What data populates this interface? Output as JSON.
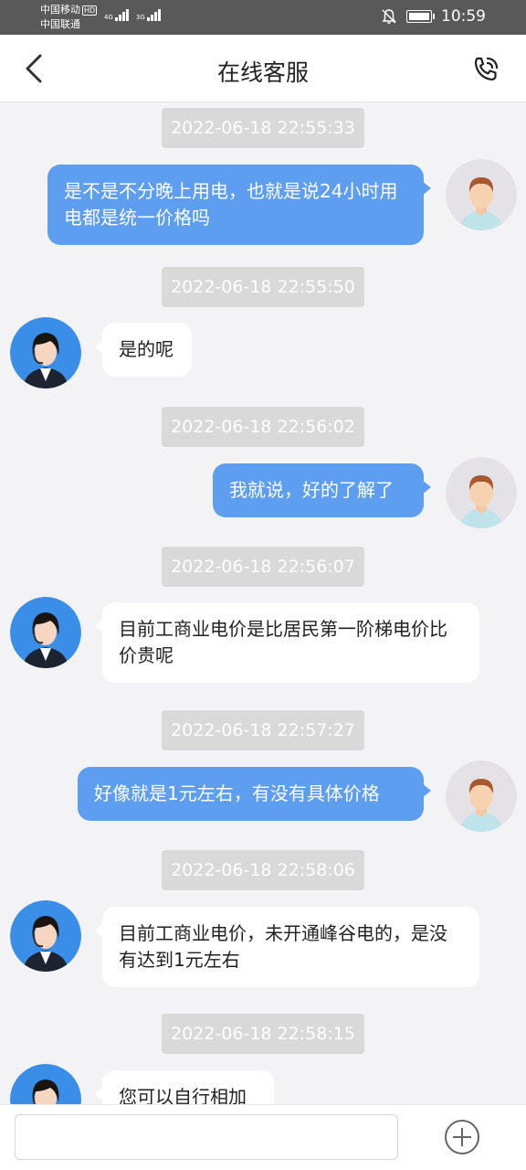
{
  "status_bar": {
    "carrier1": "中国移动",
    "hd": "HD",
    "carrier2": "中国联通",
    "sig1": "4G",
    "sig2": "3G",
    "time": "10:59"
  },
  "nav": {
    "title": "在线客服",
    "back_icon": "chevron-left-icon",
    "call_icon": "phone-call-icon"
  },
  "messages": [
    {
      "timestamp": "2022-06-18 22:55:33",
      "sender": "user",
      "text": "是不是不分晚上用电，也就是说24小时用电都是统一价格吗"
    },
    {
      "timestamp": "2022-06-18 22:55:50",
      "sender": "agent",
      "text": "是的呢"
    },
    {
      "timestamp": "2022-06-18 22:56:02",
      "sender": "user",
      "text": "我就说，好的了解了"
    },
    {
      "timestamp": "2022-06-18 22:56:07",
      "sender": "agent",
      "text": "目前工商业电价是比居民第一阶梯电价比价贵呢"
    },
    {
      "timestamp": "2022-06-18 22:57:27",
      "sender": "user",
      "text": "好像就是1元左右，有没有具体价格"
    },
    {
      "timestamp": "2022-06-18 22:58:06",
      "sender": "agent",
      "text": "目前工商业电价，未开通峰谷电的，是没有达到1元左右"
    },
    {
      "timestamp": "2022-06-18 22:58:15",
      "sender": "agent",
      "text": "您可以自行相加"
    }
  ],
  "input": {
    "value": "",
    "plus_icon": "plus-circle-icon"
  },
  "colors": {
    "status_bg": "#595959",
    "outgoing_bubble": "#5d9ef0",
    "incoming_bubble": "#ffffff",
    "timestamp_bg": "#d9d9d9",
    "chat_bg": "#f3f3f5"
  }
}
